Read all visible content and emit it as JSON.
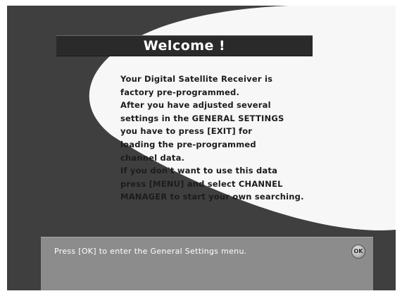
{
  "dialog": {
    "title": "Welcome !",
    "message_lines": [
      "Your Digital Satellite Receiver is",
      "factory pre-programmed.",
      "After you have adjusted several",
      "settings in the GENERAL SETTINGS",
      "you have to press [EXIT] for",
      "loading the pre-programmed",
      "channel data.",
      "If you don't want to use this data",
      "press [MENU] and select CHANNEL",
      "MANAGER to start your own searching."
    ]
  },
  "info_bar": {
    "text": "Press [OK] to enter the General Settings menu.",
    "ok_icon": "ok-button-icon",
    "ok_icon_label": "OK"
  },
  "colors": {
    "background": "#3f3f3f",
    "swoosh": "#f7f7f7",
    "title_bar": "#2a2a2a",
    "info_panel": "#8c8c8c"
  }
}
